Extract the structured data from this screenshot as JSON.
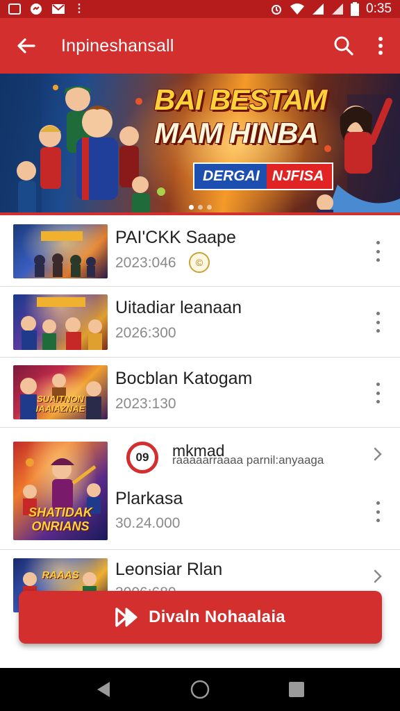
{
  "status_bar": {
    "time": "0:35",
    "left_icons": [
      "gallery-icon",
      "messenger-icon",
      "mail-icon"
    ],
    "right_icons": [
      "alarm-icon",
      "wifi-icon",
      "signal-icon",
      "battery-icon"
    ]
  },
  "app_bar": {
    "title": "Inpineshansall",
    "back_icon": "arrow-left-icon",
    "search_icon": "search-icon",
    "more_icon": "more-vertical-icon"
  },
  "banner": {
    "headline_line1": "BAI BESTAM",
    "headline_line2": "MAM HINBA",
    "tag_left": "DERGAI",
    "tag_right": "NJFISA",
    "page_count": 3,
    "active_page": 1
  },
  "list": {
    "items": [
      {
        "title": "PAI'CKK Saape",
        "meta": "2023:046",
        "badge": "©",
        "action": "more-vertical-icon"
      },
      {
        "title": "Uitadiar leanaan",
        "meta": "2026:300",
        "action": "more-vertical-icon"
      },
      {
        "title": "Bocblan Katogam",
        "meta": "2023:130",
        "action": "more-vertical-icon"
      },
      {
        "timer": "09",
        "subtitle": "mkmad",
        "caption": "raaaaarraaaa parnil:anyaaga",
        "title": "Plarkasa",
        "meta": "30.24.000",
        "actions": [
          "chevron-right-icon",
          "more-vertical-icon"
        ]
      },
      {
        "title": "Leonsiar Rlan",
        "meta": "3006:680",
        "action": "chevron-right-icon"
      }
    ],
    "thumb_texts": [
      "",
      "",
      "SUAITNON IAAIAZNAE",
      "SHATIDAK ONRIANS",
      "RAAAS"
    ]
  },
  "cta": {
    "label": "Divaln Nohaalaia",
    "icon": "fast-forward-icon"
  },
  "nav_bar": {
    "back": "nav-back-icon",
    "home": "nav-home-icon",
    "recents": "nav-recents-icon"
  },
  "colors": {
    "primary": "#d32f2f",
    "status_bar": "#b71c1c",
    "text": "#222222",
    "meta_text": "#8a8a8a"
  }
}
